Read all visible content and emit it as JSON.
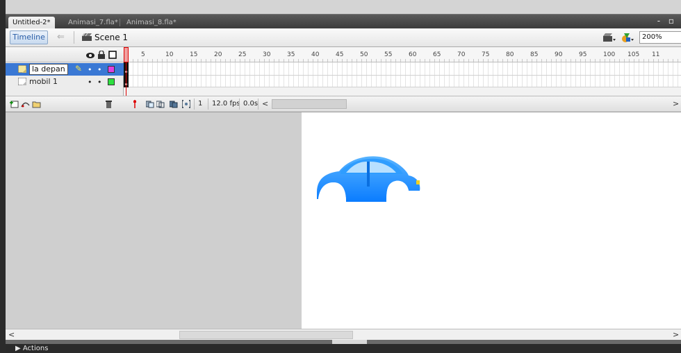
{
  "tabs": [
    {
      "label": "Untitled-2*"
    },
    {
      "label": "Animasi_7.fla*"
    },
    {
      "label": "Animasi_8.fla*"
    }
  ],
  "window_buttons": "- ▫",
  "editbar": {
    "timeline_label": "Timeline",
    "scene_label": "Scene 1",
    "zoom": "200%"
  },
  "layers": [
    {
      "name": "la depan",
      "color": "#e040e0",
      "selected": true
    },
    {
      "name": "mobil 1",
      "color": "#2ee040",
      "selected": false
    }
  ],
  "ruler_ticks": [
    "5",
    "10",
    "15",
    "20",
    "25",
    "30",
    "35",
    "40",
    "45",
    "50",
    "55",
    "60",
    "65",
    "70",
    "75",
    "80",
    "85",
    "90",
    "95",
    "100",
    "105",
    "11"
  ],
  "status": {
    "current_frame": "1",
    "frame_rate": "12.0 fps",
    "elapsed": "0.0s"
  },
  "actions_panel": {
    "label": "Actions"
  },
  "colors": {
    "car_body": "#1a8cff",
    "selection": "#3a78d4"
  }
}
